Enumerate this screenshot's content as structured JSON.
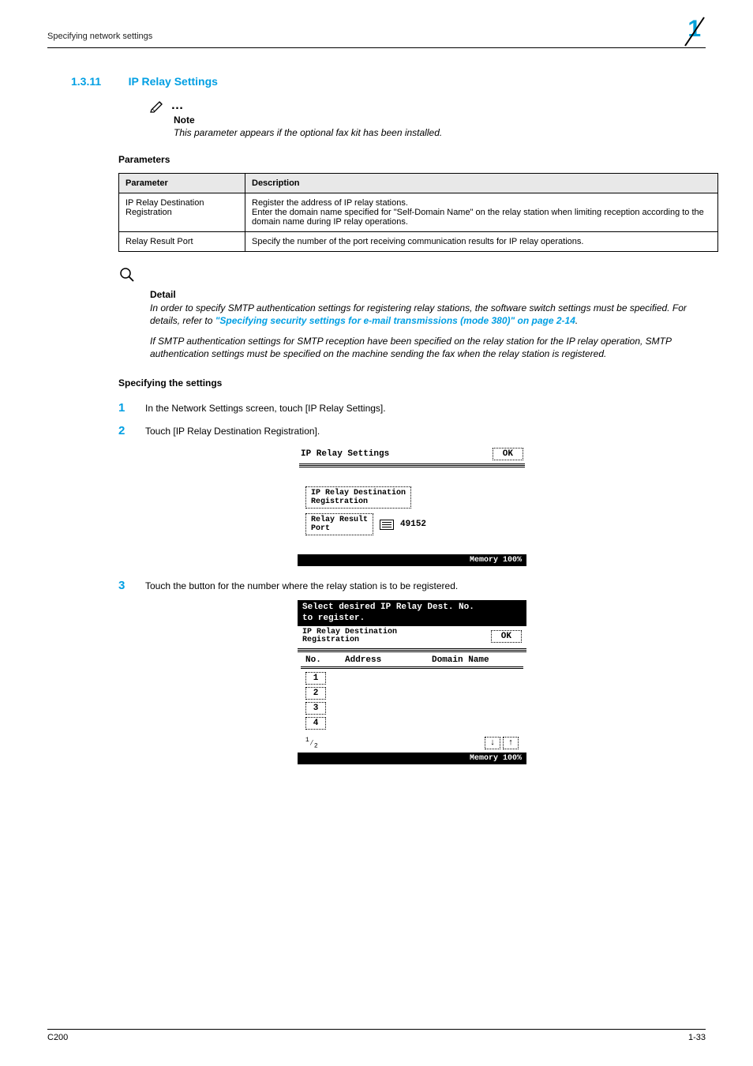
{
  "header": {
    "left": "Specifying network settings",
    "chapter_num": "1"
  },
  "section": {
    "number": "1.3.11",
    "title": "IP Relay Settings"
  },
  "note": {
    "label": "Note",
    "text": "This parameter appears if the optional fax kit has been installed."
  },
  "parameters_heading": "Parameters",
  "params_table": {
    "head": {
      "c1": "Parameter",
      "c2": "Description"
    },
    "rows": [
      {
        "c1": "IP Relay Destination Registration",
        "c2": "Register the address of IP relay stations.\nEnter the domain name specified for \"Self-Domain Name\" on the relay station when limiting reception according to the domain name during IP relay operations."
      },
      {
        "c1": "Relay Result Port",
        "c2": "Specify the number of the port receiving communication results for IP relay operations."
      }
    ]
  },
  "detail": {
    "label": "Detail",
    "p1_a": "In order to specify SMTP authentication settings for registering relay stations, the software switch settings must be specified. For details, refer to ",
    "p1_link": "\"Specifying security settings for e-mail transmissions (mode 380)\" on page 2-14",
    "p1_b": ".",
    "p2": "If SMTP authentication settings for SMTP reception have been specified on the relay station for the IP relay operation, SMTP authentication settings must be specified on the machine sending the fax when the relay station is registered."
  },
  "specifying_heading": "Specifying the settings",
  "steps": {
    "s1": {
      "num": "1",
      "text": "In the Network Settings screen, touch [IP Relay Settings]."
    },
    "s2": {
      "num": "2",
      "text": "Touch [IP Relay Destination Registration]."
    },
    "s3": {
      "num": "3",
      "text": "Touch the button for the number where the relay station is to be registered."
    }
  },
  "lcd1": {
    "title": "IP Relay Settings",
    "ok": "OK",
    "btn1_l1": "IP Relay Destination",
    "btn1_l2": "Registration",
    "btn2_l1": "Relay Result",
    "btn2_l2": "Port",
    "port": "49152",
    "memory": "Memory 100%"
  },
  "lcd2": {
    "msg_l1": "Select desired IP Relay Dest. No.",
    "msg_l2": "to register.",
    "sub_l1": "IP Relay Destination",
    "sub_l2": "Registration",
    "ok": "OK",
    "col_no": "No.",
    "col_addr": "Address",
    "col_domain": "Domain Name",
    "rows": [
      "1",
      "2",
      "3",
      "4"
    ],
    "page": "1⁄2",
    "memory": "Memory 100%"
  },
  "footer": {
    "left": "C200",
    "right": "1-33"
  }
}
